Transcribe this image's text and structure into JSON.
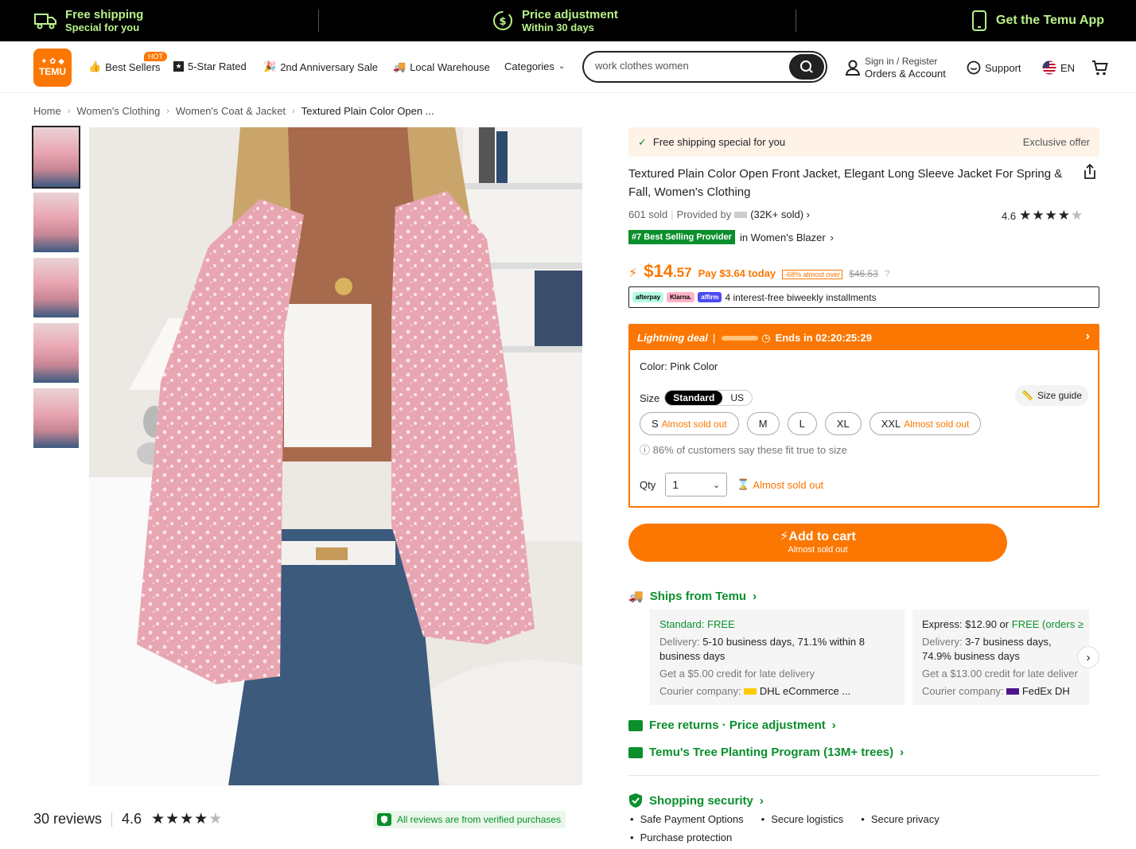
{
  "promo": {
    "shipping_title": "Free shipping",
    "shipping_sub": "Special for you",
    "price_title": "Price adjustment",
    "price_sub": "Within 30 days",
    "app": "Get the Temu App"
  },
  "header": {
    "logo_text": "TEMU",
    "nav": [
      "Best Sellers",
      "5-Star Rated",
      "2nd Anniversary Sale",
      "Local Warehouse",
      "Categories"
    ],
    "hot_badge": "HOT",
    "search_value": "work clothes women",
    "sign_in": "Sign in / Register",
    "orders": "Orders & Account",
    "support": "Support",
    "language": "EN"
  },
  "breadcrumb": [
    "Home",
    "Women's Clothing",
    "Women's Coat & Jacket",
    "Textured Plain Color Open ..."
  ],
  "product": {
    "free_shipping": "Free shipping special for you",
    "exclusive": "Exclusive offer",
    "title": "Textured Plain Color Open Front Jacket, Elegant Long Sleeve Jacket For Spring & Fall, Women's Clothing",
    "sold": "601 sold",
    "provided_by": "Provided by",
    "provider_sold": "(32K+ sold)",
    "rating": "4.6",
    "best_badge": "#7 Best Selling Provider",
    "best_in": "in Women's Blazer",
    "price_main": "$14",
    "price_cents": ".57",
    "pay_today": "Pay $3.64 today",
    "discount": "-68% almost over",
    "original_price": "$46.53",
    "installments": "4 interest-free biweekly installments",
    "pay_logos": [
      "afterpay",
      "Klarna.",
      "affirm"
    ]
  },
  "deal": {
    "label": "Lightning deal",
    "ends": "Ends in 02:20:25:29",
    "color_label": "Color: Pink Color",
    "size_label": "Size",
    "size_systems": [
      "Standard",
      "US"
    ],
    "size_guide": "Size guide",
    "sizes": [
      {
        "label": "S",
        "note": "Almost sold out"
      },
      {
        "label": "M",
        "note": ""
      },
      {
        "label": "L",
        "note": ""
      },
      {
        "label": "XL",
        "note": ""
      },
      {
        "label": "XXL",
        "note": "Almost sold out"
      }
    ],
    "fit_note": "86% of customers say these fit true to size",
    "qty_label": "Qty",
    "qty_value": "1",
    "qty_note": "Almost sold out"
  },
  "cart": {
    "label": "Add to cart",
    "sub": "Almost sold out"
  },
  "shipping": {
    "title": "Ships from Temu",
    "standard": {
      "head_label": "Standard:",
      "head_value": "FREE",
      "delivery_label": "Delivery:",
      "delivery_value": "5-10 business days, 71.1% within 8 business days",
      "credit": "Get a $5.00 credit for late delivery",
      "courier_label": "Courier company:",
      "courier": "DHL eCommerce ..."
    },
    "express": {
      "head_label": "Express: $12.90 or",
      "head_value": "FREE (orders ≥",
      "delivery_label": "Delivery:",
      "delivery_value": "3-7 business days, 74.9% business days",
      "credit": "Get a $13.00 credit for late deliver",
      "courier_label": "Courier company:",
      "courier": "FedEx  DH"
    }
  },
  "links": {
    "returns": "Free returns · Price adjustment",
    "tree": "Temu's Tree Planting Program (13M+ trees)",
    "security": "Shopping security",
    "security_items": [
      "Safe Payment Options",
      "Secure logistics",
      "Secure privacy",
      "Purchase protection"
    ]
  },
  "reviews": {
    "count": "30 reviews",
    "rating": "4.6",
    "verified": "All reviews are from verified purchases"
  },
  "colors": {
    "brand": "#fb7701",
    "green": "#0a8f2c"
  }
}
